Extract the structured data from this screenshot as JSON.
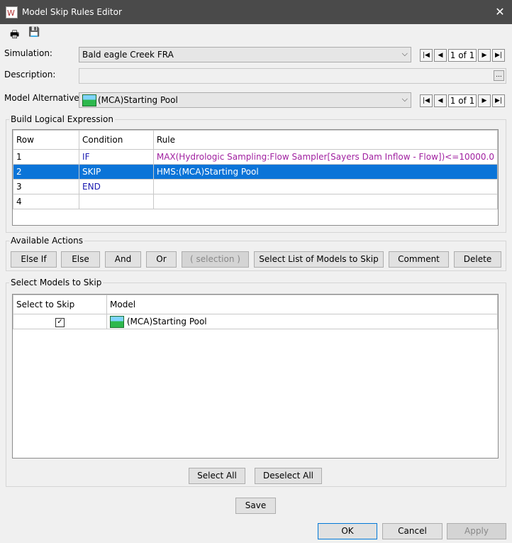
{
  "window": {
    "title": "Model Skip Rules Editor",
    "close_glyph": "✕"
  },
  "toolbar": {
    "print_glyph": "🖶",
    "save_glyph": "💾"
  },
  "simulation": {
    "label": "Simulation:",
    "value": "Bald eagle Creek FRA",
    "count": "1 of 1"
  },
  "description": {
    "label": "Description:",
    "value": "",
    "ellipsis": "..."
  },
  "model_alternative": {
    "label": "Model Alternative:",
    "value": "(MCA)Starting Pool",
    "count": "1 of 1"
  },
  "build": {
    "label": "Build Logical Expression",
    "headers": [
      "Row",
      "Condition",
      "Rule"
    ],
    "rows": [
      {
        "row": "1",
        "condition": "IF",
        "rule": "MAX(Hydrologic Sampling:Flow Sampler[Sayers Dam Inflow - Flow])<=10000.0"
      },
      {
        "row": "2",
        "condition": "SKIP",
        "rule": "HMS:(MCA)Starting Pool"
      },
      {
        "row": "3",
        "condition": "END",
        "rule": ""
      },
      {
        "row": "4",
        "condition": "",
        "rule": ""
      }
    ]
  },
  "actions": {
    "label": "Available Actions",
    "else_if": "Else If",
    "else": "Else",
    "and": "And",
    "or": "Or",
    "selection": "( selection )",
    "select_list": "Select List of Models to Skip",
    "comment": "Comment",
    "delete": "Delete"
  },
  "models": {
    "label": "Select Models to Skip",
    "headers": [
      "Select to Skip",
      "Model"
    ],
    "rows": [
      {
        "checked": "✓",
        "model": "(MCA)Starting Pool"
      }
    ],
    "select_all": "Select All",
    "deselect_all": "Deselect All"
  },
  "footer": {
    "save": "Save",
    "ok": "OK",
    "cancel": "Cancel",
    "apply": "Apply"
  },
  "colors": {
    "selection": "#0a74d8",
    "keyword": "#1a1ab0",
    "rule_text": "#a020a0"
  }
}
